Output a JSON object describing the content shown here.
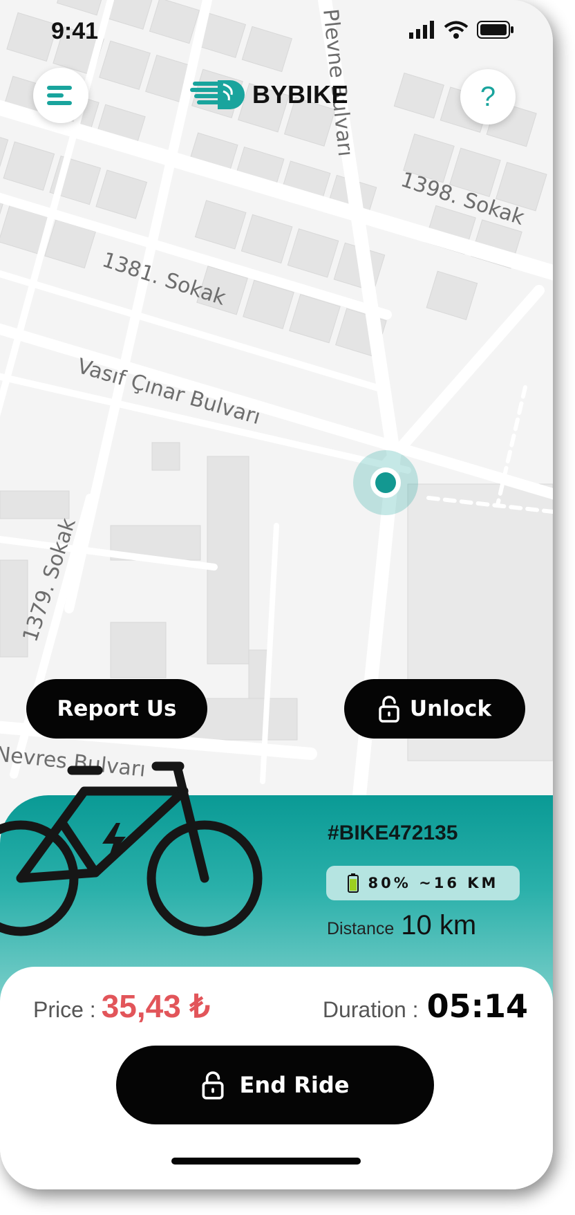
{
  "status_bar": {
    "time": "9:41"
  },
  "header": {
    "brand": "BYBIKE",
    "menu_icon": "hamburger-menu-icon",
    "help_label": "?"
  },
  "map": {
    "streets": [
      {
        "label": "Plevne Bulvarı"
      },
      {
        "label": "1398. Sokak"
      },
      {
        "label": "1381. Sokak"
      },
      {
        "label": "Vasıf Çınar Bulvarı"
      },
      {
        "label": "1379. Sokak"
      },
      {
        "label": "Nevres Bulvarı"
      }
    ]
  },
  "actions": {
    "report_label": "Report Us",
    "unlock_label": "Unlock",
    "unlock_icon": "unlock-icon"
  },
  "bike": {
    "id": "#BIKE472135",
    "battery_text": "80% ~16 KM",
    "battery_level": 0.8,
    "distance_label": "Distance",
    "distance_value": "10 km"
  },
  "ride": {
    "price_label": "Price :",
    "price_value": "35,43 ₺",
    "duration_label": "Duration :",
    "duration_value": "05:14",
    "end_label": "End Ride"
  },
  "colors": {
    "accent": "#19a49d",
    "price": "#e2555a",
    "button": "#050505"
  }
}
